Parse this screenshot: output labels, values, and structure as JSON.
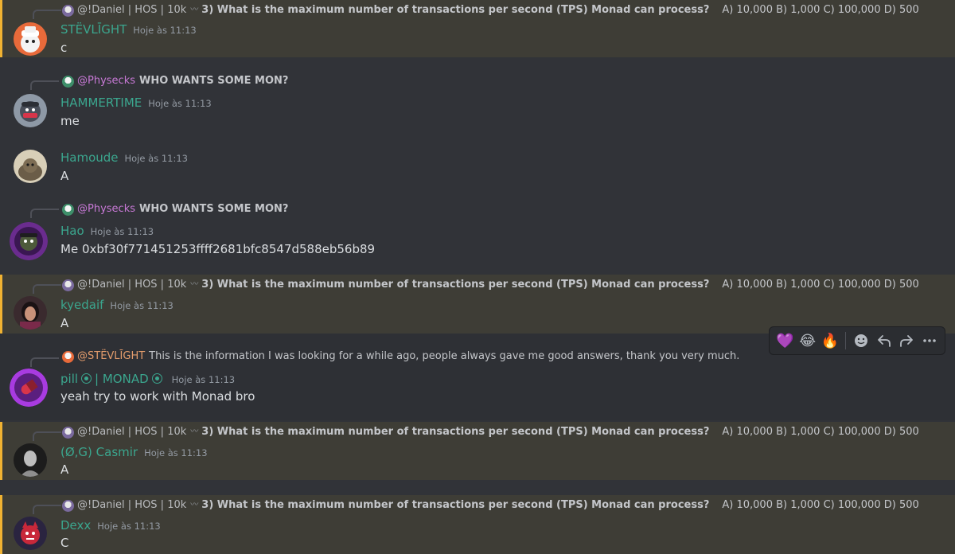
{
  "colors": {
    "background": "#313338",
    "mention_bg": "#3e3d36",
    "mention_border": "#f0b232",
    "username": "#3ba68e",
    "reply_pink": "#c879d6"
  },
  "messages": [
    {
      "reply": {
        "name": "@!Daniel | HOS | 10k",
        "text": "3) What is the maximum number of transactions per second (TPS) Monad can process?",
        "extra": "A) 10,000 B) 1,000 C) 100,000 D) 500"
      },
      "username": "STËVLĪGHT",
      "timestamp": "Hoje às 11:13",
      "content": "c"
    },
    {
      "reply": {
        "name": "@Physecks",
        "text": "WHO WANTS SOME MON?"
      },
      "username": "HAMMERTIME",
      "timestamp": "Hoje às 11:13",
      "content": "me"
    },
    {
      "username": "Hamoude",
      "timestamp": "Hoje às 11:13",
      "content": "A"
    },
    {
      "reply": {
        "name": "@Physecks",
        "text": "WHO WANTS SOME MON?"
      },
      "username": "Hao",
      "timestamp": "Hoje às 11:13",
      "content": "Me 0xbf30f771451253ffff2681bfc8547d588eb56b89"
    },
    {
      "reply": {
        "name": "@!Daniel | HOS | 10k",
        "text": "3) What is the maximum number of transactions per second (TPS) Monad can process?",
        "extra": "A) 10,000 B) 1,000 C) 100,000 D) 500"
      },
      "username": "kyedaif",
      "timestamp": "Hoje às 11:13",
      "content": "A"
    },
    {
      "reply": {
        "name": "@STËVLĪGHT",
        "text": "This is the information I was looking for a while ago, people always gave me good answers, thank you very much."
      },
      "username_part1": "pill",
      "username_part2": "| MONAD",
      "timestamp": "Hoje às 11:13",
      "content": "yeah try to work with Monad bro"
    },
    {
      "reply": {
        "name": "@!Daniel | HOS | 10k",
        "text": "3) What is the maximum number of transactions per second (TPS) Monad can process?",
        "extra": "A) 10,000 B) 1,000 C) 100,000 D) 500"
      },
      "username": "(Ø,G) Casmir",
      "timestamp": "Hoje às 11:13",
      "content": "A"
    },
    {
      "reply": {
        "name": "@!Daniel | HOS | 10k",
        "text": "3) What is the maximum number of transactions per second (TPS) Monad can process?",
        "extra": "A) 10,000 B) 1,000 C) 100,000 D) 500"
      },
      "username": "Dexx",
      "timestamp": "Hoje às 11:13",
      "content": "C"
    }
  ],
  "toolbar": {
    "reactions": [
      "💜",
      "😂",
      "🔥"
    ],
    "icons": [
      "add-reaction-icon",
      "reply-icon",
      "forward-icon",
      "more-icon"
    ]
  }
}
